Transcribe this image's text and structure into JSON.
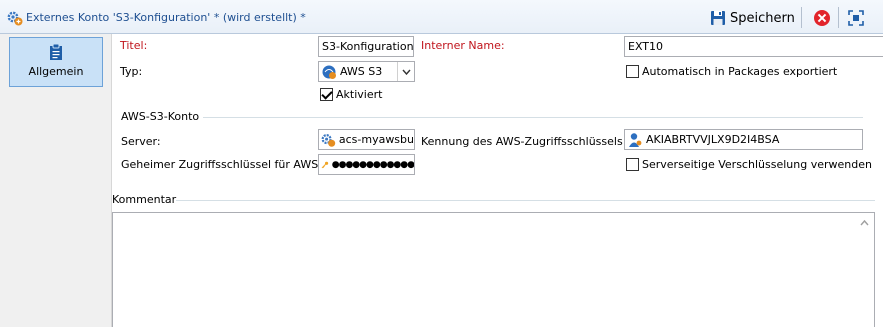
{
  "window": {
    "title": "Externes Konto 'S3-Konfiguration' * (wird erstellt) *",
    "save_label": "Speichern"
  },
  "nav": {
    "items": [
      {
        "label": "Allgemein",
        "icon": "clipboard-icon"
      }
    ]
  },
  "form": {
    "titel_label": "Titel:",
    "titel_value": "S3-Konfiguration",
    "interner_name_label": "Interner Name:",
    "interner_name_value": "EXT10",
    "typ_label": "Typ:",
    "typ_value": "AWS S3",
    "auto_export_label": "Automatisch in Packages exportiert",
    "auto_export_checked": false,
    "aktiviert_label": "Aktiviert",
    "aktiviert_checked": true
  },
  "aws": {
    "group_label": "AWS-S3-Konto",
    "server_label": "Server:",
    "server_value": "acs-myawsbu",
    "key_id_label": "Kennung des AWS-Zugriffsschlüssels:",
    "key_id_value": "AKIABRTVVJLX9D2I4BSA",
    "secret_label": "Geheimer Zugriffsschlüssel für AWS:",
    "secret_value": "●●●●●●●●●●●●",
    "encryption_label": "Serverseitige Verschlüsselung verwenden",
    "encryption_checked": false
  },
  "comment": {
    "label": "Kommentar",
    "value": ""
  },
  "colors": {
    "title_blue": "#1e4f91",
    "required_red": "#c0141c",
    "nav_selected": "#c9e1f7",
    "close_red": "#e2242b"
  }
}
